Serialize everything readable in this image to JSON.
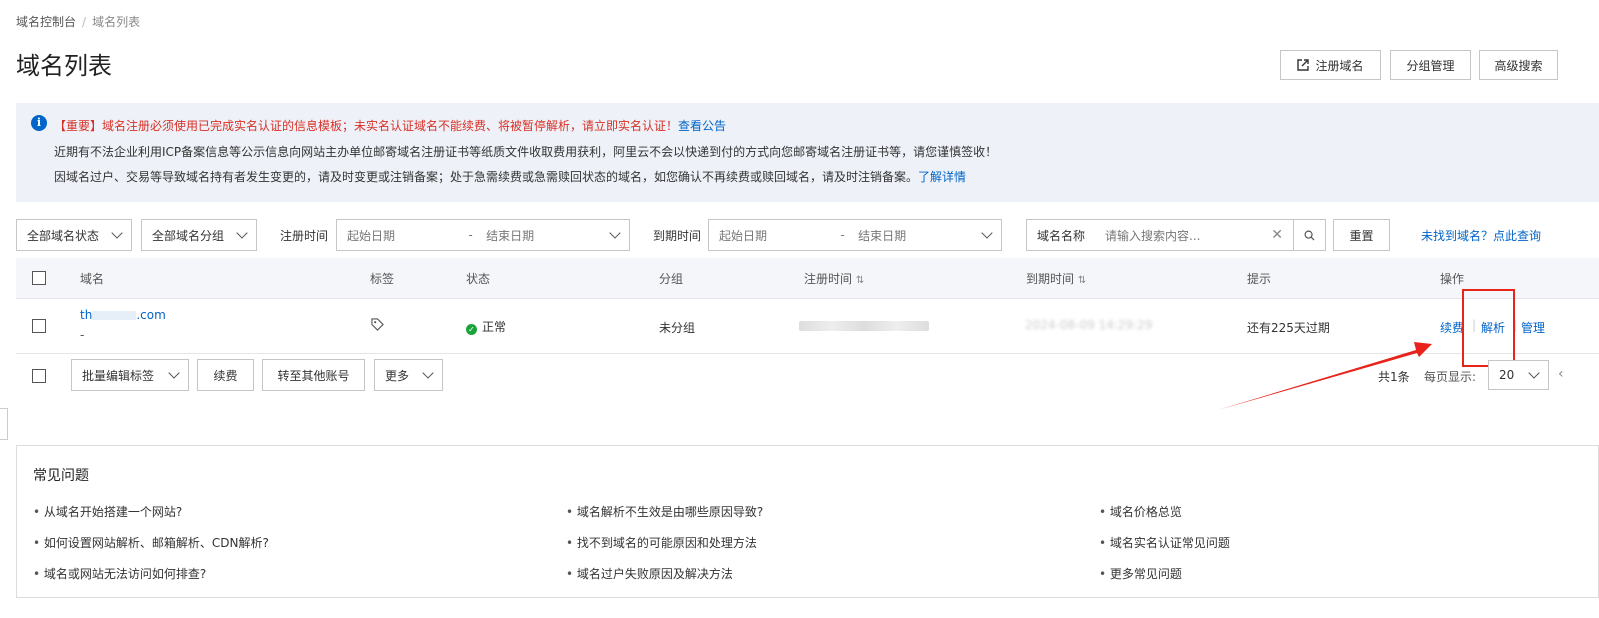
{
  "breadcrumb": {
    "root": "域名控制台",
    "current": "域名列表"
  },
  "page_title": "域名列表",
  "header_buttons": {
    "register": "注册域名",
    "group": "分组管理",
    "advanced": "高级搜索"
  },
  "notice": {
    "line1": "【重要】域名注册必须使用已完成实名认证的信息模板；未实名认证域名不能续费、将被暂停解析，请立即实名认证！",
    "line1_link": "查看公告",
    "line2": "近期有不法企业利用ICP备案信息等公示信息向网站主办单位邮寄域名注册证书等纸质文件收取费用获利，阿里云不会以快递到付的方式向您邮寄域名注册证书等，请您谨慎签收！",
    "line3": "因域名过户、交易等导致域名持有者发生变更的，请及时变更或注销备案；处于急需续费或急需赎回状态的域名，如您确认不再续费或赎回域名，请及时注销备案。",
    "line3_link": "了解详情"
  },
  "filters": {
    "status": "全部域名状态",
    "group": "全部域名分组",
    "reg_label": "注册时间",
    "exp_label": "到期时间",
    "start_ph": "起始日期",
    "end_ph": "结束日期",
    "dash": "-",
    "search_type": "域名名称",
    "search_ph": "请输入搜索内容...",
    "reset": "重置",
    "not_found_link": "未找到域名？点此查询"
  },
  "table": {
    "headers": {
      "domain": "域名",
      "tag": "标签",
      "status": "状态",
      "group": "分组",
      "reg_time": "注册时间",
      "exp_time": "到期时间",
      "hint": "提示",
      "ops": "操作"
    },
    "sort_icon": "⇅",
    "row": {
      "domain_visible": "th",
      "domain_suffix": ".com",
      "domain_sub": "-",
      "status": "正常",
      "group": "未分组",
      "exp_time_partial": "2024-08-09 14:29:29",
      "hint": "还有225天过期",
      "op_renew": "续费",
      "op_dns": "解析",
      "op_manage": "管理"
    }
  },
  "bulk": {
    "edit_tags": "批量编辑标签",
    "renew": "续费",
    "transfer": "转至其他账号",
    "more": "更多",
    "total": "共1条",
    "per_page_label": "每页显示:",
    "per_page": "20"
  },
  "faq": {
    "title": "常见问题",
    "items": [
      "从域名开始搭建一个网站?",
      "域名解析不生效是由哪些原因导致?",
      "域名价格总览",
      "如何设置网站解析、邮箱解析、CDN解析?",
      "找不到域名的可能原因和处理方法",
      "域名实名认证常见问题",
      "域名或网站无法访问如何排查?",
      "域名过户失败原因及解决方法",
      "更多常见问题"
    ]
  },
  "colors": {
    "accent": "#0064c8",
    "danger": "#d93026",
    "success": "#1aa33b"
  }
}
